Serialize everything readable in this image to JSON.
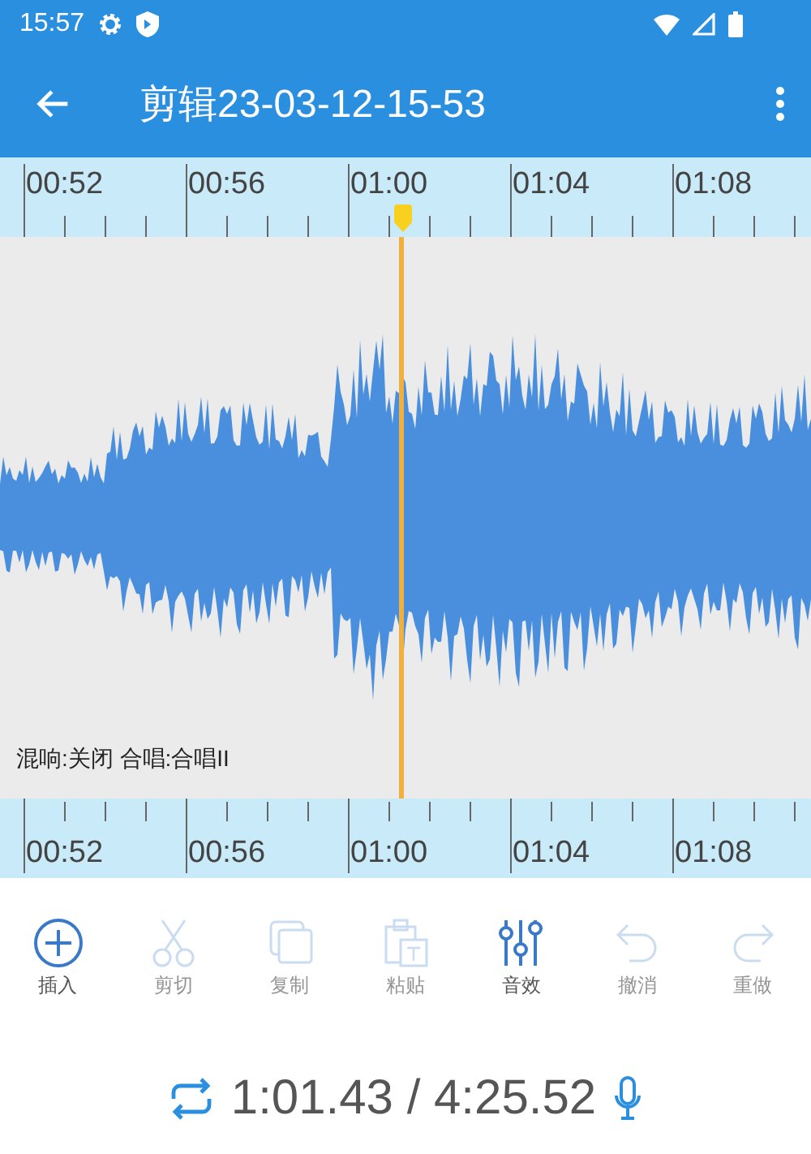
{
  "status_bar": {
    "time": "15:57"
  },
  "app_bar": {
    "title": "剪辑23-03-12-15-53"
  },
  "top_ruler": {
    "labels": [
      "00:52",
      "00:56",
      "01:00",
      "01:04",
      "01:08"
    ]
  },
  "waveform": {
    "caption": "混响:关闭 合唱:合唱II"
  },
  "bottom_ruler": {
    "labels": [
      "00:52",
      "00:56",
      "01:00",
      "01:04",
      "01:08"
    ]
  },
  "toolbar": [
    {
      "kind": "insert",
      "label": "插入",
      "disabled": false
    },
    {
      "kind": "cut",
      "label": "剪切",
      "disabled": true
    },
    {
      "kind": "copy",
      "label": "复制",
      "disabled": true
    },
    {
      "kind": "paste",
      "label": "粘贴",
      "disabled": true
    },
    {
      "kind": "effects",
      "label": "音效",
      "disabled": false
    },
    {
      "kind": "undo",
      "label": "撤消",
      "disabled": true
    },
    {
      "kind": "redo",
      "label": "重做",
      "disabled": true
    }
  ],
  "playback": {
    "time": "1:01.43 / 4:25.52"
  }
}
